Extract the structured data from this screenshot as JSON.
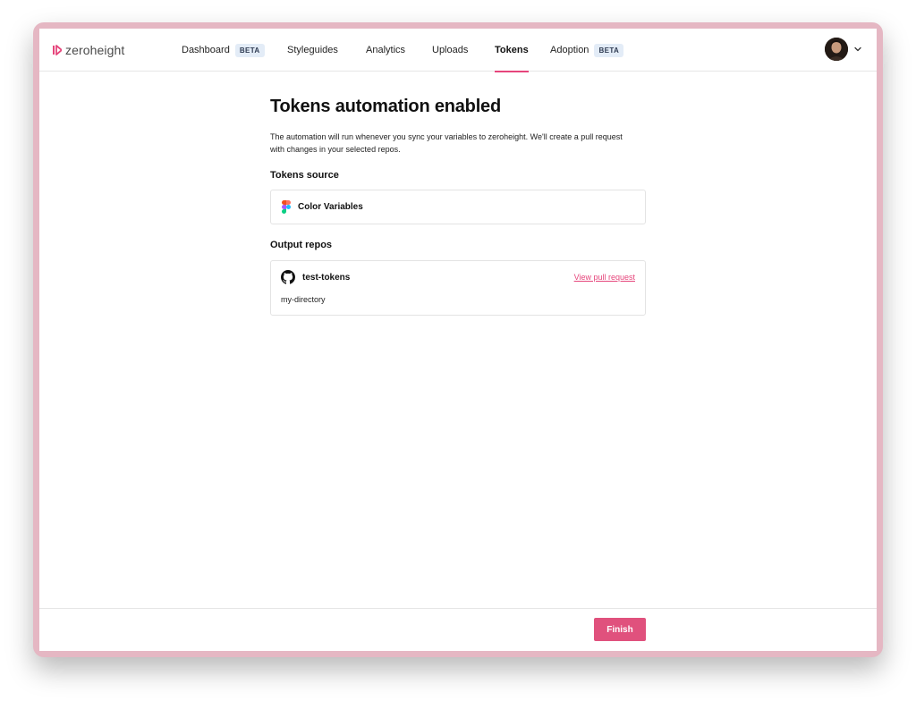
{
  "brand": {
    "name": "zeroheight",
    "accent": "#e6457b"
  },
  "nav": {
    "items": [
      {
        "label": "Dashboard",
        "badge": "BETA"
      },
      {
        "label": "Styleguides"
      },
      {
        "label": "Analytics"
      },
      {
        "label": "Uploads"
      },
      {
        "label": "Tokens",
        "active": true
      },
      {
        "label": "Adoption",
        "badge": "BETA"
      }
    ]
  },
  "user": {
    "avatar_icon": "user-avatar"
  },
  "main": {
    "title": "Tokens automation enabled",
    "description": "The automation will run whenever you sync your variables to zeroheight. We'll create a pull request with changes in your selected repos.",
    "source_label": "Tokens source",
    "source": {
      "name": "Color Variables",
      "icon": "figma-icon"
    },
    "repos_label": "Output repos",
    "repos": [
      {
        "name": "test-tokens",
        "directory": "my-directory",
        "link_label": "View pull request",
        "icon": "github-icon"
      }
    ]
  },
  "footer": {
    "finish_label": "Finish"
  }
}
